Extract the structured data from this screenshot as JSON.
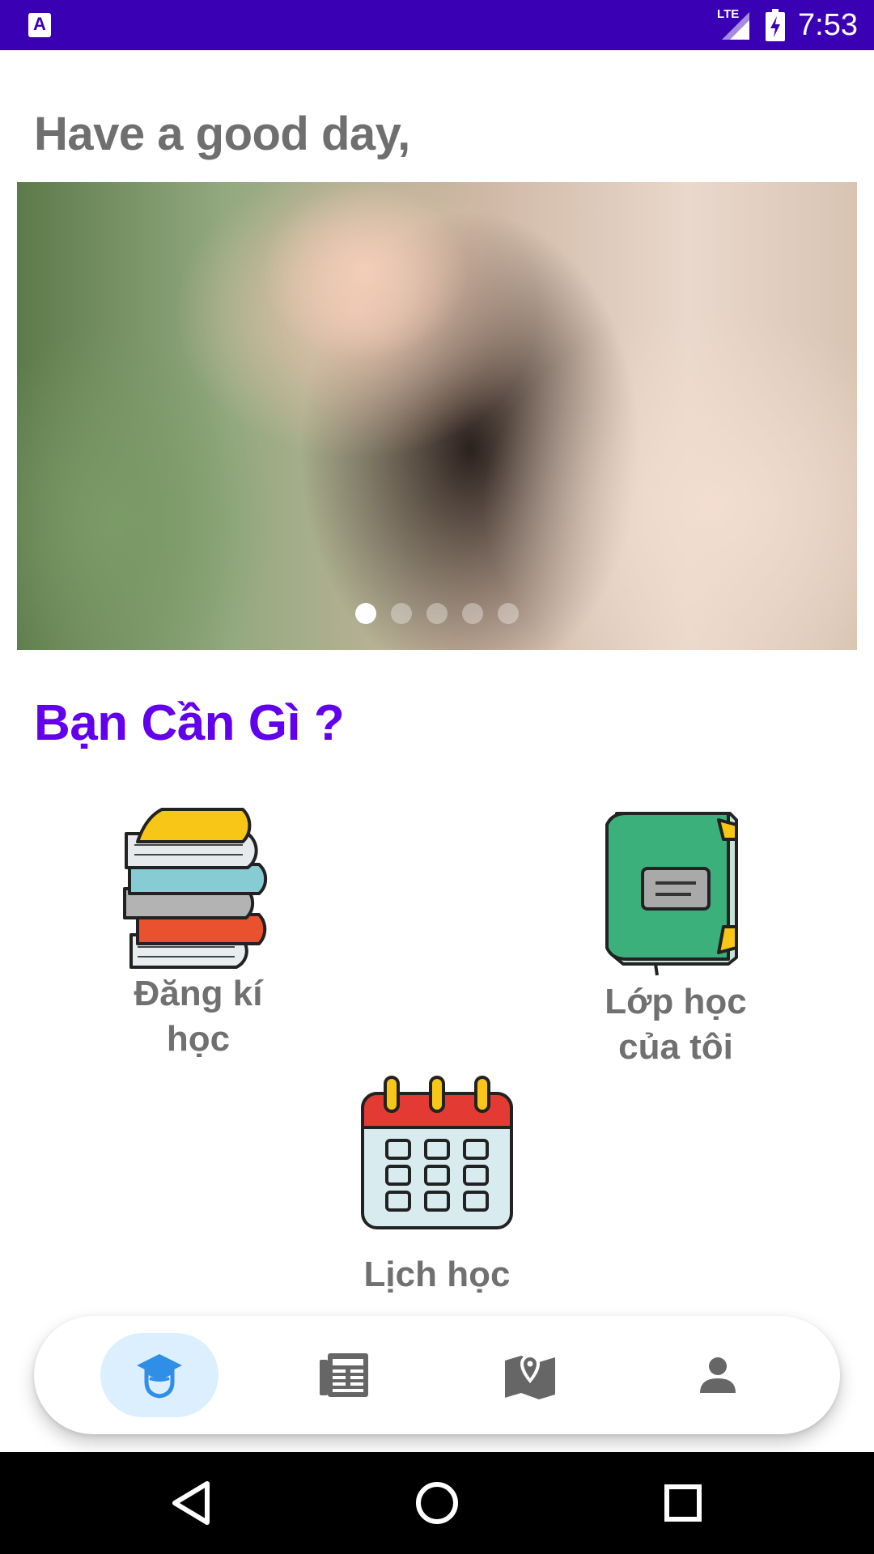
{
  "status_bar": {
    "time": "7:53",
    "network": "LTE",
    "icons": [
      "app-notification-icon",
      "lte-signal-icon",
      "battery-charging-icon"
    ]
  },
  "greeting": "Have a good day,",
  "banner": {
    "slide_count": 5,
    "active_slide": 1
  },
  "section_title": "Bạn Cần Gì ?",
  "features": {
    "register": {
      "line1": "Đăng kí",
      "line2": "học",
      "icon": "books-stack-icon"
    },
    "my_class": {
      "line1": "Lớp học",
      "line2": "của tôi",
      "icon": "green-book-icon"
    },
    "schedule": {
      "line1": "Lịch học",
      "icon": "calendar-icon"
    }
  },
  "bottom_nav": {
    "active": "home",
    "items": [
      {
        "id": "home",
        "icon": "graduation-cap-icon"
      },
      {
        "id": "news",
        "icon": "newspaper-icon"
      },
      {
        "id": "map",
        "icon": "map-icon"
      },
      {
        "id": "profile",
        "icon": "person-icon"
      }
    ]
  },
  "colors": {
    "status_bar": "#3a00b3",
    "section_title": "#6200ee",
    "greeting": "#6f6f6f",
    "nav_active_bg": "#dcefff"
  }
}
